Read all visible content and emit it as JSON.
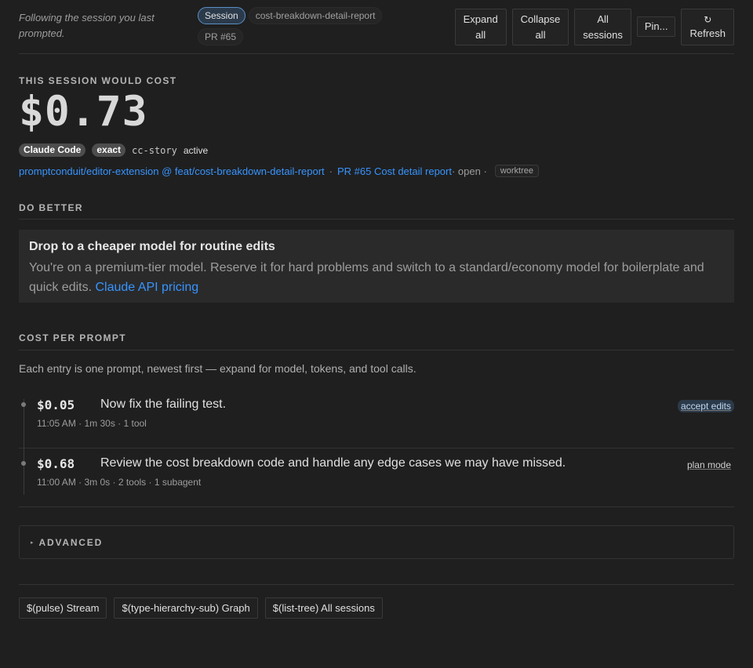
{
  "header": {
    "following_text": "Following the session you last prompted.",
    "chips": [
      "Session",
      "cost-breakdown-detail-report",
      "PR #65"
    ],
    "buttons": {
      "expand_all": [
        "Expand",
        "all"
      ],
      "collapse_all": [
        "Collapse",
        "all"
      ],
      "all_sessions": [
        "All",
        "sessions"
      ],
      "pin": "Pin...",
      "refresh_icon": "↻",
      "refresh": "Refresh"
    }
  },
  "cost": {
    "label": "THIS SESSION WOULD COST",
    "amount": "$0.73",
    "tags": [
      "Claude Code",
      "exact"
    ],
    "project": "cc-story",
    "status": "active"
  },
  "repo": {
    "branch_link": "promptconduit/editor-extension @ feat/cost-breakdown-detail-report",
    "sep": "·",
    "pr_link": "PR #65 Cost detail report",
    "pr_state": "· open ·",
    "worktree": "worktree"
  },
  "do_better": {
    "label": "DO BETTER",
    "tip_title": "Drop to a cheaper model for routine edits",
    "tip_body": "You're on a premium-tier model. Reserve it for hard problems and switch to a standard/economy model for boilerplate and quick edits.",
    "tip_link": "Claude API pricing"
  },
  "cost_per_prompt": {
    "label": "COST PER PROMPT",
    "description": "Each entry is one prompt, newest first — expand for model, tokens, and tool calls.",
    "entries": [
      {
        "cost": "$0.05",
        "prompt": "Now fix the failing test.",
        "meta": "11:05 AM · 1m 30s · 1 tool",
        "mode": "accept edits"
      },
      {
        "cost": "$0.68",
        "prompt": "Review the cost breakdown code and handle any edge cases we may have missed.",
        "meta": "11:00 AM · 3m 0s · 2 tools · 1 subagent",
        "mode": "plan mode"
      }
    ]
  },
  "advanced": {
    "arrow": "▸",
    "label": "ADVANCED"
  },
  "footer": {
    "stream": "$(pulse) Stream",
    "graph": "$(type-hierarchy-sub) Graph",
    "all_sessions": "$(list-tree) All sessions"
  },
  "colors": {
    "accent_link": "#3794ff",
    "background": "#1f1f1f"
  }
}
